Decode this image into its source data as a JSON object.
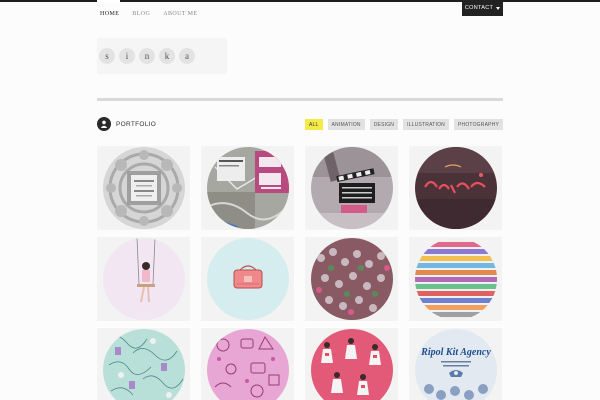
{
  "nav": {
    "items": [
      "HOME",
      "BLOG",
      "ABOUT ME"
    ],
    "active_index": 0,
    "contact_label": "CONTACT"
  },
  "logo": {
    "letters": [
      "s",
      "i",
      "n",
      "k",
      "a"
    ]
  },
  "portfolio": {
    "title": "PORTFOLIO",
    "filters": [
      "ALL",
      "ANIMATION",
      "DESIGN",
      "ILLUSTRATION",
      "PHOTOGRAPHY"
    ],
    "active_filter_index": 0,
    "accent_color": "#f4ea48",
    "thumbnails": [
      {
        "icon": "snowflake-poster-thumbnail",
        "caption": "",
        "color": "#c8c8c8"
      },
      {
        "icon": "map-collage-thumbnail",
        "caption": "",
        "color": "#8a8a8a"
      },
      {
        "icon": "clapperboard-thumbnail",
        "caption": "",
        "color": "#9b8f95"
      },
      {
        "icon": "neon-sign-thumbnail",
        "caption": "",
        "color": "#5a3a40"
      },
      {
        "icon": "swing-girl-thumbnail",
        "caption": "",
        "color": "#f0e4f0"
      },
      {
        "icon": "pink-bag-thumbnail",
        "caption": "",
        "color": "#d8eef0"
      },
      {
        "icon": "beads-thumbnail",
        "caption": "",
        "color": "#9a6070"
      },
      {
        "icon": "rainbow-stripes-thumbnail",
        "caption": "",
        "color": "#d4a0b8"
      },
      {
        "icon": "sketch-pattern-thumbnail",
        "caption": "",
        "color": "#8fc8c0"
      },
      {
        "icon": "pink-doodles-thumbnail",
        "caption": "",
        "color": "#e6a0d0"
      },
      {
        "icon": "fashion-figures-thumbnail",
        "caption": "",
        "color": "#e06080"
      },
      {
        "icon": "agency-poster-thumbnail",
        "caption": "Ripol Kit Agency",
        "color": "#dde6ef"
      }
    ]
  }
}
